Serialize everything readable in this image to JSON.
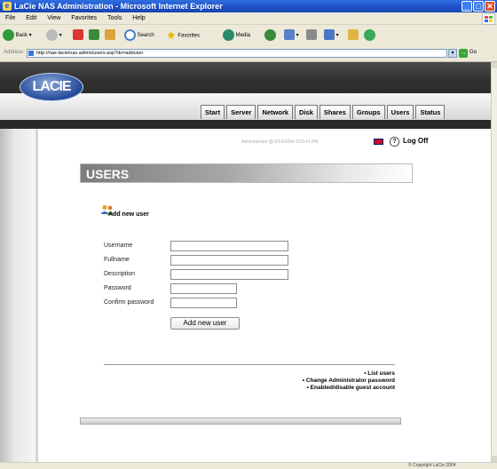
{
  "window": {
    "title": "LaCie NAS Administration - Microsoft Internet Explorer"
  },
  "menu": [
    "File",
    "Edit",
    "View",
    "Favorites",
    "Tools",
    "Help"
  ],
  "toolbar": {
    "back": "Back",
    "search": "Search",
    "favorites": "Favorites",
    "media": "Media"
  },
  "address": {
    "label": "Address",
    "url": "http://nas-lacie/nas.admin/users.asp?do=adduser",
    "go": "Go"
  },
  "logo": "LACIE",
  "nav_tabs": [
    "Start",
    "Server",
    "Network",
    "Disk",
    "Shares",
    "Groups",
    "Users",
    "Status"
  ],
  "session": {
    "status": "Administrator @ 8/14/2004 5:53:41 PM",
    "logoff": "Log Off"
  },
  "page": {
    "title": "USERS",
    "section": "Add new user"
  },
  "form": {
    "fields": [
      {
        "label": "Username",
        "value": ""
      },
      {
        "label": "Fullname",
        "value": ""
      },
      {
        "label": "Description",
        "value": ""
      },
      {
        "label": "Password",
        "value": ""
      },
      {
        "label": "Confirm password",
        "value": ""
      }
    ],
    "submit": "Add new user"
  },
  "links": [
    "• List users",
    "• Change Administrator password",
    "• Enabled/disable guest account"
  ],
  "footer": {
    "copyright": "© Copyright LaCie 2004"
  },
  "colors": {
    "titlebar": "#1d4fc4",
    "header": "#2e2e2e",
    "logo": "#234a9a"
  }
}
